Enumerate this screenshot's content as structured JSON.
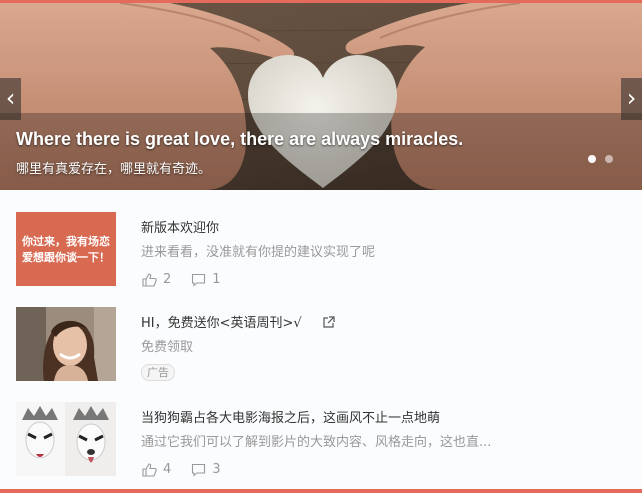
{
  "banner": {
    "caption_en": "Where there is great love, there are always miracles.",
    "caption_zh": "哪里有真爱存在，哪里就有奇迹。",
    "prev_icon": "chevron-left",
    "next_icon": "chevron-right",
    "slide_count": 2,
    "active_slide": 1
  },
  "feed": {
    "items": [
      {
        "thumb_text_line1": "你过来，我有场恋",
        "thumb_text_line2": "爱想跟你谈一下！",
        "title": "新版本欢迎你",
        "desc": "进来看看，没准就有你提的建议实现了呢",
        "likes": "2",
        "comments": "1"
      },
      {
        "title": "HI，免费送你<英语周刊>√",
        "desc": "免费领取",
        "ad_label": "广告"
      },
      {
        "title": "当狗狗霸占各大电影海报之后，这画风不止一点地萌",
        "desc": "通过它我们可以了解到影片的大致内容、风格走向，这也直...",
        "likes": "4",
        "comments": "3"
      }
    ]
  },
  "colors": {
    "accent": "#e46a5b",
    "text_primary": "#333333",
    "text_secondary": "#999999"
  }
}
